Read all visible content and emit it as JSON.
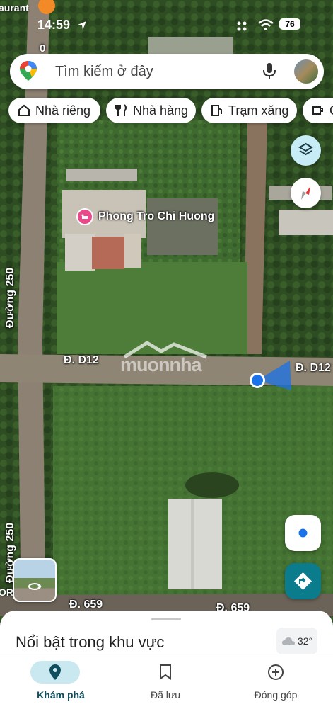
{
  "status_bar": {
    "partial_label": "aurant",
    "time": "14:59",
    "battery": "76"
  },
  "search": {
    "placeholder": "Tìm kiếm ở đây"
  },
  "chips": [
    {
      "label": "Nhà riêng",
      "icon": "home-icon"
    },
    {
      "label": "Nhà hàng",
      "icon": "restaurant-icon"
    },
    {
      "label": "Trạm xăng",
      "icon": "gas-station-icon"
    },
    {
      "label": "C",
      "icon": "coffee-icon"
    }
  ],
  "map": {
    "place_name": "Phong Tro Chi Huong",
    "place_icon": "lodging-icon",
    "roads": {
      "duong_250_top": "Đường 250",
      "duong_250_bottom": "Đường 250",
      "d12_left": "Đ. D12",
      "d12_right": "Đ. D12",
      "r659_left": "Đ. 659",
      "r659_right": "Đ. 659",
      "partial_left": "OR",
      "partial_top": "0"
    },
    "watermark": "muonnha",
    "colors": {
      "location_blue": "#1a73e8",
      "layers_button": "#c7ecf6",
      "directions_button": "#0b7c8c",
      "place_pin": "#e94b8a"
    }
  },
  "sheet": {
    "title": "Nổi bật trong khu vực",
    "weather": "32°"
  },
  "bottom_nav": [
    {
      "label": "Khám phá",
      "icon": "explore-pin-icon",
      "active": true
    },
    {
      "label": "Đã lưu",
      "icon": "bookmark-icon",
      "active": false
    },
    {
      "label": "Đóng góp",
      "icon": "add-circle-icon",
      "active": false
    }
  ]
}
